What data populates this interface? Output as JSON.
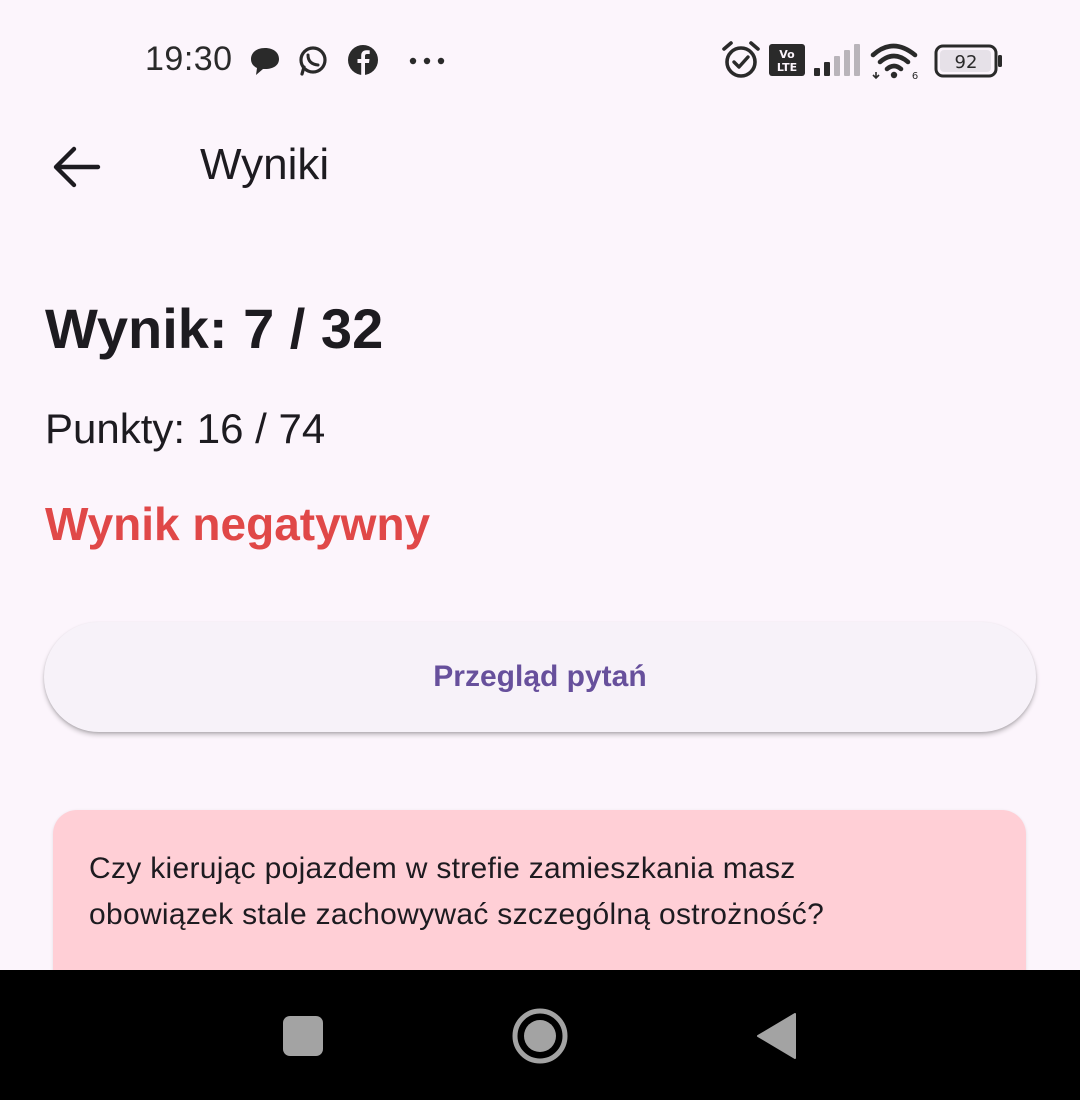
{
  "status_bar": {
    "time": "19:30",
    "battery_level": "92",
    "wifi_badge": "6",
    "icons": [
      "message-icon",
      "whatsapp-icon",
      "facebook-icon",
      "more-notifications-icon",
      "alarm-icon",
      "volte-icon",
      "signal-icon",
      "wifi-icon",
      "battery-icon"
    ]
  },
  "app_bar": {
    "title": "Wyniki",
    "back_icon": "arrow-left-icon"
  },
  "results": {
    "score": "Wynik: 7 / 32",
    "points": "Punkty: 16 / 74",
    "verdict": "Wynik negatywny"
  },
  "review_button": {
    "label": "Przegląd pytań"
  },
  "question_card": {
    "line1": "Czy kierując pojazdem w strefie zamieszkania masz",
    "line2": "obowiązek stale zachowywać szczególną ostrożność?"
  },
  "nav_bar": {
    "icons": [
      "recents-square-icon",
      "home-circle-icon",
      "back-triangle-icon"
    ]
  },
  "colors": {
    "background": "#fcf5fc",
    "negative": "#e04848",
    "button_text": "#67509c",
    "card_background": "#ffcfd6"
  }
}
